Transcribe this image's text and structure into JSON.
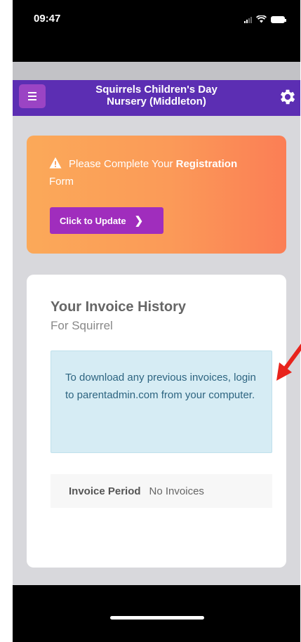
{
  "status": {
    "time": "09:47"
  },
  "header": {
    "title": "Squirrels Children's Day Nursery (Middleton)"
  },
  "registration": {
    "message_prefix": "Please Complete Your ",
    "message_bold": "Registration",
    "message_line2": "Form",
    "button_label": "Click to Update",
    "button_chevron": "❯"
  },
  "invoices": {
    "title": "Your Invoice History",
    "subtitle": "For Squirrel",
    "info": "To download any previous invoices, login to parentadmin.com from your computer.",
    "period_label": "Invoice Period",
    "period_value": "No Invoices"
  },
  "icons": {
    "menu": "hamburger-icon",
    "settings": "gear-icon",
    "warning": "warning-triangle-icon"
  },
  "colors": {
    "header": "#5c2eb3",
    "menu_button": "#9b44c4",
    "update_button": "#a02dbd",
    "info_bg": "#d6ecf4",
    "annotation": "#e8231c"
  }
}
